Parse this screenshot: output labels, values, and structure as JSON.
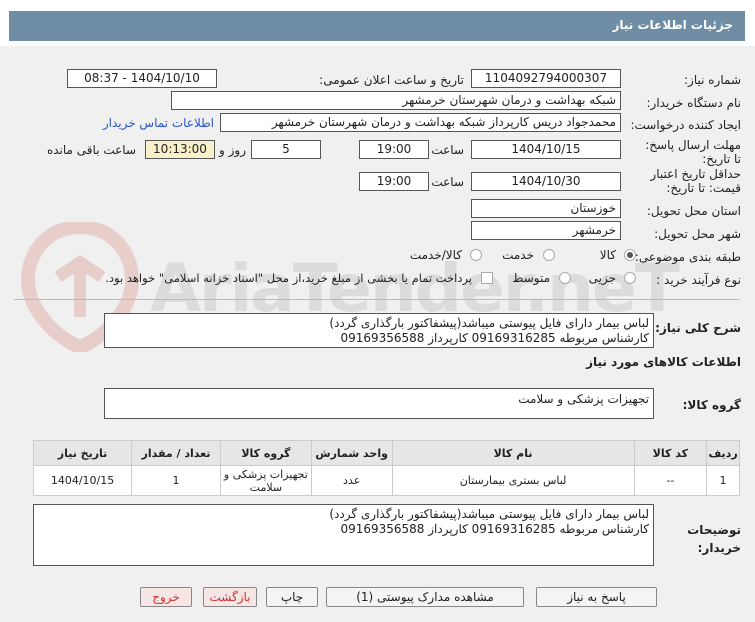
{
  "header": {
    "title": "جزئیات اطلاعات نیاز"
  },
  "labels": {
    "need_number": "شماره نیاز:",
    "announce_datetime": "تاریخ و ساعت اعلان عمومی:",
    "buyer_org": "نام دستگاه خریدار:",
    "requester": "ایجاد کننده درخواست:",
    "contact_link": "اطلاعات تماس خریدار",
    "deadline": "مهلت ارسال پاسخ: تا تاریخ:",
    "min_validity": "حداقل تاریخ اعتبار قیمت: تا تاریخ:",
    "time": "ساعت",
    "days_and": "روز و",
    "remaining": "ساعت باقی مانده",
    "province": "استان محل تحویل:",
    "city": "شهر محل تحویل:",
    "category": "طبقه بندی موضوعی:",
    "purchase_type": "نوع فرآیند خرید :",
    "general_desc": "شرح کلی نیاز:",
    "goods_info": "اطلاعات کالاهای مورد نیاز",
    "goods_group": "گروه کالا:",
    "buyer_notes": "توضیحات خریدار:"
  },
  "fields": {
    "need_number": "1104092794000307",
    "announce_datetime": "1404/10/10 - 08:37",
    "buyer_org": "شبکه بهداشت و درمان شهرستان خرمشهر",
    "requester": "محمدجواد دریس کارپرداز شبکه بهداشت و درمان شهرستان خرمشهر",
    "deadline_date": "1404/10/15",
    "deadline_time": "19:00",
    "days": "5",
    "remaining_time": "10:13:00",
    "validity_date": "1404/10/30",
    "validity_time": "19:00",
    "province": "خوزستان",
    "city": "خرمشهر",
    "general_desc_line1": "لباس بیمار دارای فایل پیوستی میباشد(پیشفاکتور بارگذاری گردد)",
    "general_desc_line2": "کارشناس مربوطه 09169316285 کارپرداز 09169356588",
    "goods_group": "تجهیزات پزشکی و سلامت",
    "notes_line1": "لباس بیمار دارای فایل پیوستی میباشد(پیشفاکتور بارگذاری گردد)",
    "notes_line2": "کارشناس مربوطه 09169316285 کارپرداز 09169356588"
  },
  "category_options": [
    "کالا",
    "خدمت",
    "کالا/خدمت"
  ],
  "purchase_options": [
    "جزیی",
    "متوسط"
  ],
  "purchase_checkbox_text": "پرداخت تمام یا بخشی از مبلغ خرید،از محل \"اسناد خزانه اسلامی\" خواهد بود.",
  "table": {
    "headers": [
      "ردیف",
      "کد کالا",
      "نام کالا",
      "واحد شمارش",
      "گروه کالا",
      "تعداد / مقدار",
      "تاریخ نیاز"
    ],
    "rows": [
      [
        "1",
        "--",
        "لباس بستری بیمارستان",
        "عدد",
        "تجهیزات پزشکی و سلامت",
        "1",
        "1404/10/15"
      ]
    ]
  },
  "buttons": {
    "reply": "پاسخ به نیاز",
    "attachments": "مشاهده مدارک پیوستی (1)",
    "print": "چاپ",
    "back": "بازگشت",
    "exit": "خروج"
  },
  "watermark": {
    "text": "AriaTender.neT"
  },
  "colors": {
    "header_bar": "#6f8ea6",
    "remaining_bg": "#f7f0c8",
    "link": "#2a55c8"
  }
}
